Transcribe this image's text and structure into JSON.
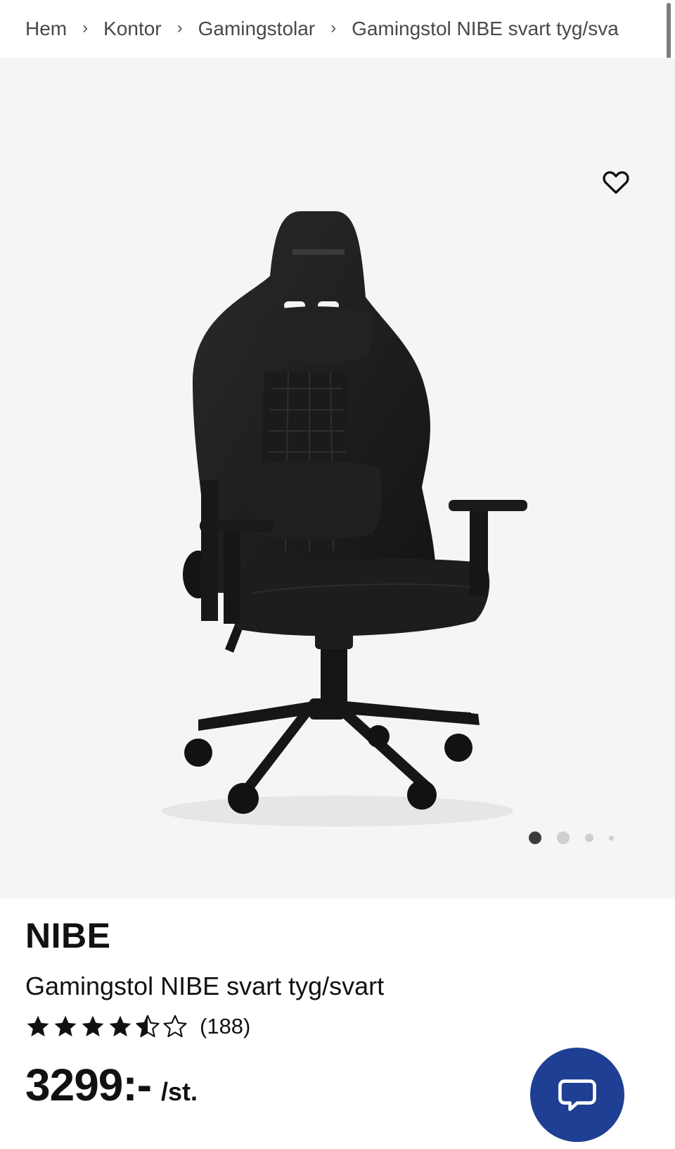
{
  "breadcrumb": {
    "items": [
      {
        "label": "Hem"
      },
      {
        "label": "Kontor"
      },
      {
        "label": "Gamingstolar"
      },
      {
        "label": "Gamingstol NIBE svart tyg/sva"
      }
    ],
    "separator": "›"
  },
  "gallery": {
    "favorite_icon": "heart-outline-icon",
    "image_count": 4,
    "active_index": 0,
    "background": "#f5f5f5"
  },
  "product": {
    "brand": "NIBE",
    "title": "Gamingstol NIBE svart tyg/svart",
    "rating": {
      "value": 4.5,
      "max": 5,
      "count_label": "(188)"
    },
    "price": "3299:-",
    "unit": "/st."
  },
  "chat": {
    "icon": "chat-bubble-icon",
    "color": "#1e3f93"
  }
}
